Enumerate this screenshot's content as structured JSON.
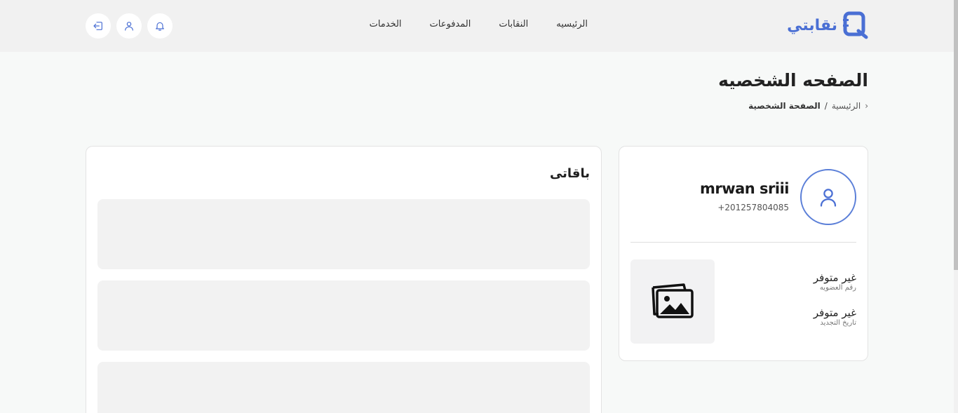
{
  "header": {
    "logo_text": "نقابتي",
    "nav": [
      "الرئيسيه",
      "النقابات",
      "المدفوعات",
      "الخدمات"
    ],
    "icons": [
      "bell-icon",
      "user-icon",
      "logout-icon"
    ]
  },
  "page": {
    "title": "الصفحه الشخصيه",
    "breadcrumb": {
      "home": "الرئيسية",
      "separator": "/",
      "current": "الصفحة الشخصية"
    }
  },
  "profile": {
    "name": "mrwan sriii",
    "phone": "+201257804085",
    "membership_number": {
      "value": "غير متوفر",
      "label": "رقم العضويه"
    },
    "renewal_date": {
      "value": "غير متوفر",
      "label": "تاريخ التجديد"
    }
  },
  "packages": {
    "title": "باقاتى"
  },
  "colors": {
    "accent": "#4a6fd4",
    "header_bg": "#f1f1f1",
    "page_bg": "#f7f9f8",
    "skeleton": "#f2f2f2"
  }
}
